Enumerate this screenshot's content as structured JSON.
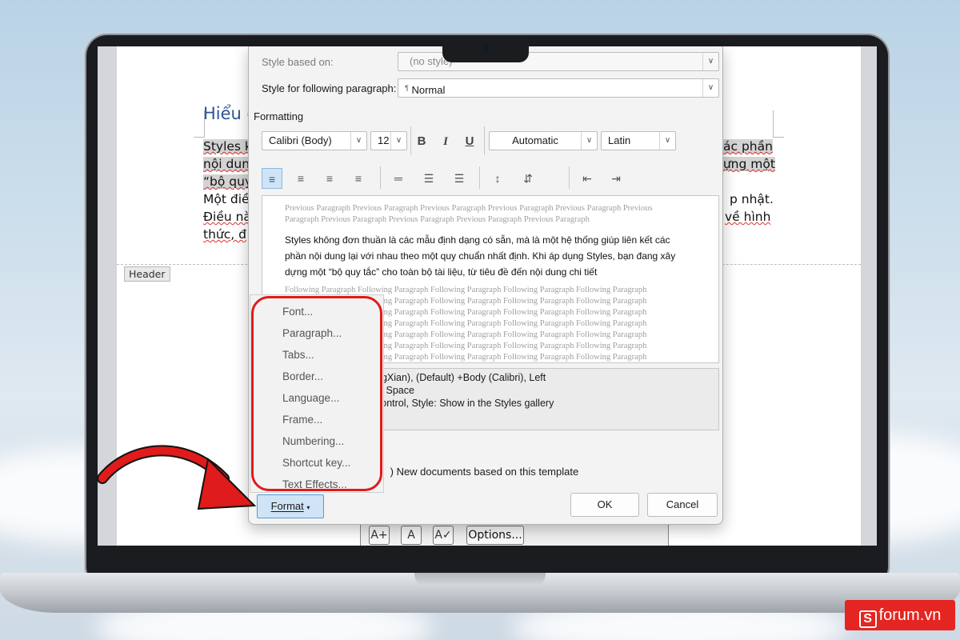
{
  "document": {
    "heading": "Hiểu c",
    "lines": [
      "Styles k",
      "nội dun",
      "“bộ quy",
      "Một điề",
      "Điều nà",
      "thức, đ"
    ],
    "right_fragments": [
      "ác phần",
      "dựng một",
      "",
      "p nhật.",
      "về hình",
      ""
    ],
    "header_label": "Header",
    "bottom_toolbar": {
      "options_label": "Options..."
    }
  },
  "dialog": {
    "style_based_on_label": "Style based on:",
    "style_based_on_value": "(no style)",
    "following_label": "Style for following paragraph:",
    "following_value": "Normal",
    "formatting_label": "Formatting",
    "font_name": "Calibri (Body)",
    "font_size": "12",
    "bold": "B",
    "italic": "I",
    "underline": "U",
    "color": "Automatic",
    "script": "Latin",
    "preview": {
      "previous_lines": [
        "Previous Paragraph Previous Paragraph Previous Paragraph Previous Paragraph Previous Paragraph Previous",
        "Paragraph Previous Paragraph Previous Paragraph Previous Paragraph Previous Paragraph"
      ],
      "sample_lines": [
        "Styles không đơn thuần là các mẫu định dạng có sẵn, mà là một hệ thống giúp liên kết các",
        "phần nội dung lại với nhau theo một quy chuẩn nhất định. Khi áp dụng Styles, bạn đang xây",
        "dựng một “bộ quy tắc” cho toàn bộ tài liệu, từ tiêu đề đến nội dung chi tiết"
      ],
      "following_lines": [
        "Following Paragraph Following Paragraph Following Paragraph Following Paragraph Following Paragraph",
        "Following Paragraph Following Paragraph Following Paragraph Following Paragraph Following Paragraph",
        "Following Paragraph Following Paragraph Following Paragraph Following Paragraph Following Paragraph",
        "Following Paragraph Following Paragraph Following Paragraph Following Paragraph Following Paragraph",
        "Following Paragraph Following Paragraph Following Paragraph Following Paragraph Following Paragraph",
        "Following Paragraph Following Paragraph Following Paragraph Following Paragraph Following Paragraph",
        "Following Paragraph Following Paragraph Following Paragraph Following Paragraph Following Paragraph"
      ]
    },
    "description_lines": [
      "ngXian), (Default) +Body (Calibri), Left",
      "li, Space",
      "control, Style: Show in the Styles gallery"
    ],
    "new_docs_label": ") New documents based on this template",
    "format_button": "Format",
    "ok_button": "OK",
    "cancel_button": "Cancel"
  },
  "format_menu": {
    "items": [
      "Font...",
      "Paragraph...",
      "Tabs...",
      "Border...",
      "Language...",
      "Frame...",
      "Numbering...",
      "Shortcut key...",
      "Text Effects..."
    ]
  },
  "watermark": {
    "brand": "forum.vn",
    "mark": "S"
  },
  "colors": {
    "highlight": "#e01b1b",
    "accent_blue": "#2f5496",
    "selection_gray": "#d3d3d3"
  }
}
